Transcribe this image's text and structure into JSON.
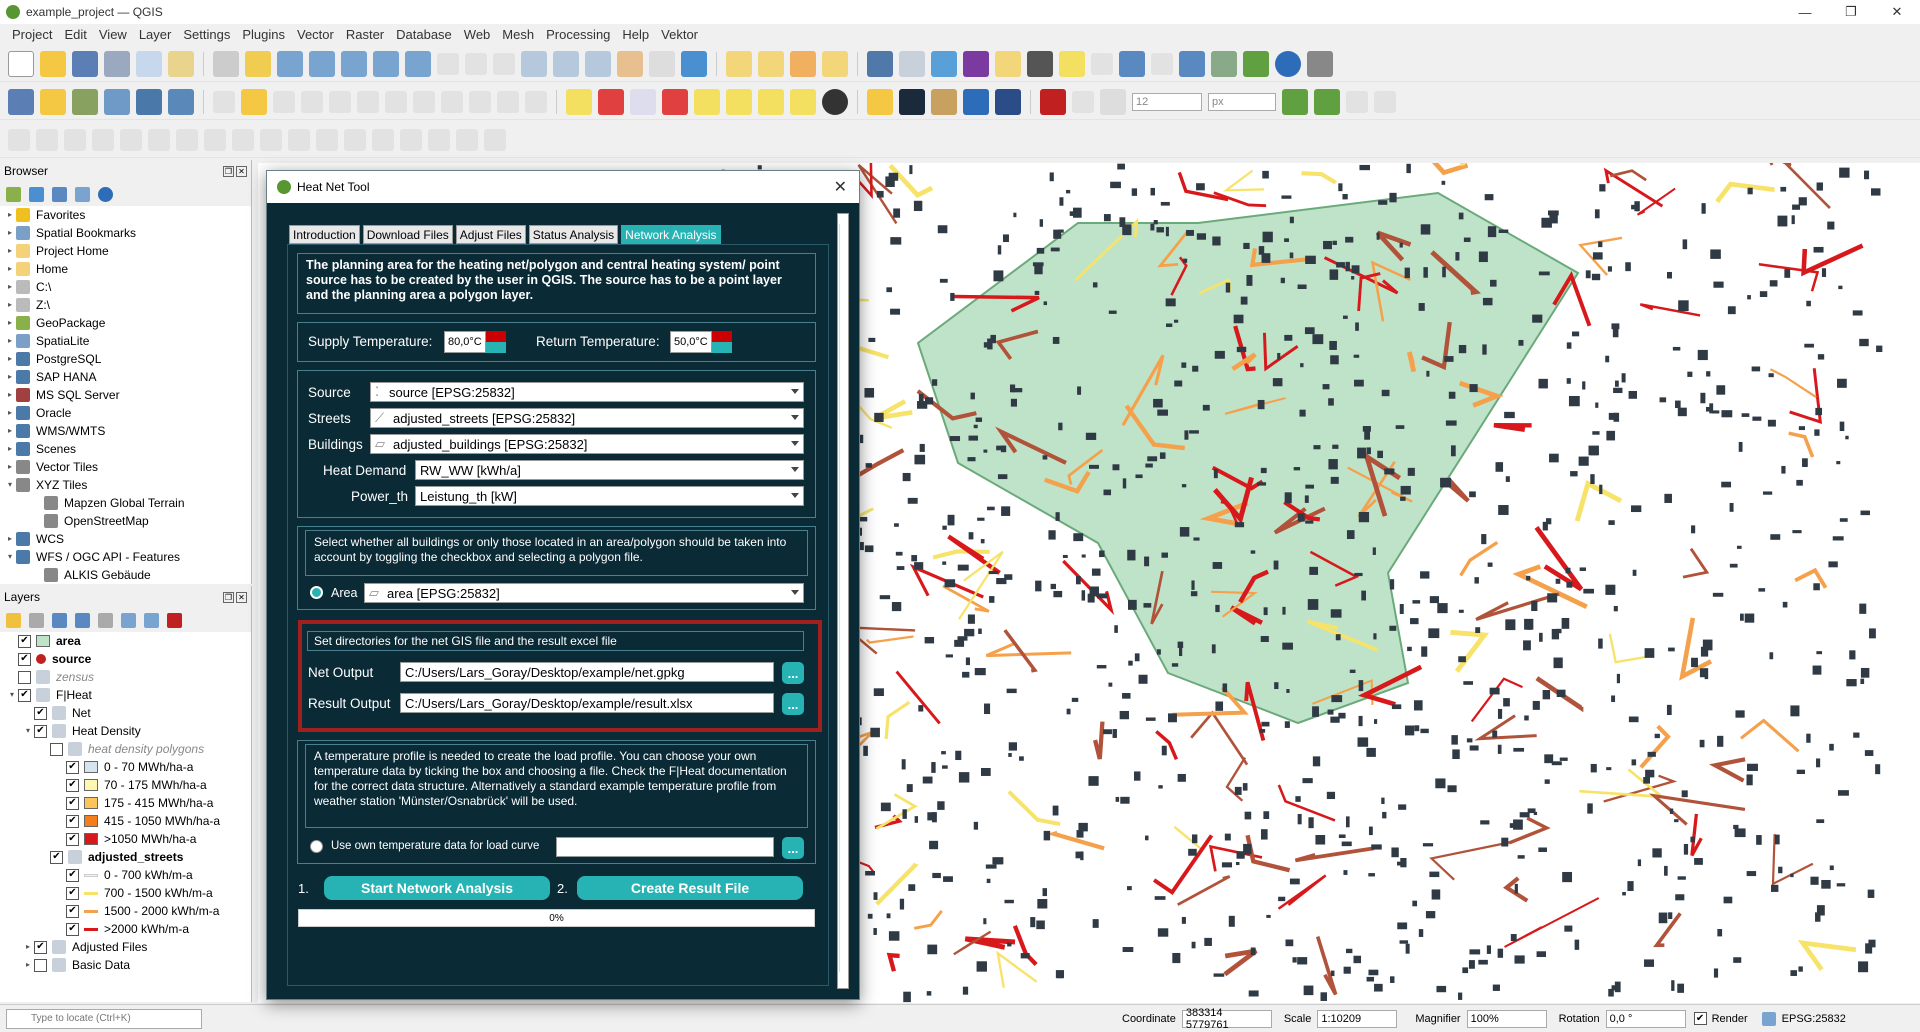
{
  "window": {
    "title": "example_project — QGIS",
    "controls": [
      "—",
      "❐",
      "✕"
    ]
  },
  "menu": [
    "Project",
    "Edit",
    "View",
    "Layer",
    "Settings",
    "Plugins",
    "Vector",
    "Raster",
    "Database",
    "Web",
    "Mesh",
    "Processing",
    "Help",
    "Vektor"
  ],
  "browser": {
    "title": "Browser",
    "items": [
      {
        "label": "Favorites",
        "icon": "star-icon",
        "color": "#f0c020"
      },
      {
        "label": "Spatial Bookmarks",
        "icon": "bookmark-icon",
        "color": "#7aa0c8"
      },
      {
        "label": "Project Home",
        "icon": "folder-icon",
        "color": "#f4d27a"
      },
      {
        "label": "Home",
        "icon": "folder-icon",
        "color": "#f4d27a"
      },
      {
        "label": "C:\\",
        "icon": "drive-icon",
        "color": "#bbbbbb"
      },
      {
        "label": "Z:\\",
        "icon": "drive-icon",
        "color": "#bbbbbb"
      },
      {
        "label": "GeoPackage",
        "icon": "geopackage-icon",
        "color": "#8ab04a"
      },
      {
        "label": "SpatiaLite",
        "icon": "spatialite-icon",
        "color": "#7aa0c8"
      },
      {
        "label": "PostgreSQL",
        "icon": "postgresql-icon",
        "color": "#4c7aa8"
      },
      {
        "label": "SAP HANA",
        "icon": "sap-hana-icon",
        "color": "#4c7aa8"
      },
      {
        "label": "MS SQL Server",
        "icon": "mssql-icon",
        "color": "#a04040"
      },
      {
        "label": "Oracle",
        "icon": "oracle-icon",
        "color": "#4c7aa8"
      },
      {
        "label": "WMS/WMTS",
        "icon": "globe-icon",
        "color": "#4c7aa8"
      },
      {
        "label": "Scenes",
        "icon": "scenes-icon",
        "color": "#4c7aa8"
      },
      {
        "label": "Vector Tiles",
        "icon": "vector-tiles-icon",
        "color": "#888888"
      },
      {
        "label": "XYZ Tiles",
        "icon": "xyz-tiles-icon",
        "color": "#888888"
      },
      {
        "label": "Mapzen Global Terrain",
        "icon": "tile-icon",
        "color": "#888888"
      },
      {
        "label": "OpenStreetMap",
        "icon": "tile-icon",
        "color": "#888888"
      },
      {
        "label": "WCS",
        "icon": "globe-icon",
        "color": "#4c7aa8"
      },
      {
        "label": "WFS / OGC API - Features",
        "icon": "globe-icon",
        "color": "#4c7aa8"
      },
      {
        "label": "ALKIS Gebäude",
        "icon": "tile-icon",
        "color": "#888888"
      }
    ]
  },
  "layers": {
    "title": "Layers",
    "items": [
      {
        "label": "area",
        "bold": true,
        "checked": true,
        "indent": 0,
        "sw": "#bfe3c9"
      },
      {
        "label": "source",
        "bold": true,
        "checked": true,
        "indent": 0,
        "dot": "#c02020"
      },
      {
        "label": "zensus",
        "italic": true,
        "checked": false,
        "indent": 0
      },
      {
        "label": "F|Heat",
        "checked": true,
        "indent": 0,
        "group": true
      },
      {
        "label": "Net",
        "checked": true,
        "indent": 1
      },
      {
        "label": "Heat Density",
        "checked": true,
        "indent": 1,
        "group": true
      },
      {
        "label": "heat density polygons",
        "italic": true,
        "checked": false,
        "indent": 2
      },
      {
        "label": "0 - 70 MWh/ha-a",
        "checked": true,
        "indent": 3,
        "sw": "#d6e4f0"
      },
      {
        "label": "70 - 175 MWh/ha-a",
        "checked": true,
        "indent": 3,
        "sw": "#fff7b0"
      },
      {
        "label": "175 - 415 MWh/ha-a",
        "checked": true,
        "indent": 3,
        "sw": "#fdc45c"
      },
      {
        "label": "415 - 1050 MWh/ha-a",
        "checked": true,
        "indent": 3,
        "sw": "#f57d1c"
      },
      {
        "label": ">1050 MWh/ha-a",
        "checked": true,
        "indent": 3,
        "sw": "#d7191c"
      },
      {
        "label": "adjusted_streets",
        "bold": true,
        "checked": true,
        "indent": 2
      },
      {
        "label": "0 - 700 kWh/m-a",
        "checked": true,
        "indent": 3,
        "ln": "#f4f4f4"
      },
      {
        "label": "700 - 1500 kWh/m-a",
        "checked": true,
        "indent": 3,
        "ln": "#f7e36a"
      },
      {
        "label": "1500 - 2000 kWh/m-a",
        "checked": true,
        "indent": 3,
        "ln": "#f5a04a"
      },
      {
        "label": ">2000 kWh/m-a",
        "checked": true,
        "indent": 3,
        "ln": "#d7191c"
      },
      {
        "label": "Adjusted Files",
        "checked": true,
        "indent": 1,
        "group": true
      },
      {
        "label": "Basic Data",
        "checked": false,
        "indent": 1,
        "group": true
      }
    ]
  },
  "dialog": {
    "title": "Heat Net Tool",
    "tabs": [
      "Introduction",
      "Download Files",
      "Adjust Files",
      "Status Analysis",
      "Network Analysis"
    ],
    "intro": "The planning area for the heating net/polygon and central heating system/ point source has to be created by the user in QGIS. The source has to be a point layer and the planning area a polygon layer.",
    "supply_label": "Supply Temperature:",
    "supply_value": "80,0°C",
    "return_label": "Return Temperature:",
    "return_value": "50,0°C",
    "source_label": "Source",
    "source_value": "source [EPSG:25832]",
    "streets_label": "Streets",
    "streets_value": "adjusted_streets [EPSG:25832]",
    "buildings_label": "Buildings",
    "buildings_value": "adjusted_buildings [EPSG:25832]",
    "heat_label": "Heat Demand",
    "heat_value": "RW_WW [kWh/a]",
    "power_label": "Power_th",
    "power_value": "Leistung_th [kW]",
    "area_info": "Select whether all buildings or only those located in an area/polygon should be taken into account by toggling the checkbox and selecting a polygon file.",
    "area_label": "Area",
    "area_value": "area [EPSG:25832]",
    "dir_info": "Set directories for the net GIS file and the result excel file",
    "net_label": "Net Output",
    "net_value": "C:/Users/Lars_Goray/Desktop/example/net.gpkg",
    "result_label": "Result Output",
    "result_value": "C:/Users/Lars_Goray/Desktop/example/result.xlsx",
    "browse": "...",
    "temp_info": "A temperature profile is needed to create the load profile. You can choose your own temperature data by ticking the box and choosing a file. Check the F|Heat documentation for the correct data structure. Alternatively a standard example temperature profile from weather station 'Münster/Osnabrück' will be used.",
    "own_temp_label": "Use own temperature data for load curve",
    "step1": "1.",
    "start_btn": "Start Network Analysis",
    "step2": "2.",
    "result_btn": "Create Result File",
    "progress": "0%"
  },
  "status": {
    "locate_placeholder": "Type to locate (Ctrl+K)",
    "coord_label": "Coordinate",
    "coord_value": "383314  5779761",
    "scale_label": "Scale",
    "scale_value": "1:10209",
    "magnifier_label": "Magnifier",
    "magnifier_value": "100%",
    "rotation_label": "Rotation",
    "rotation_value": "0,0 °",
    "render_label": "Render",
    "crs": "EPSG:25832"
  },
  "toolbar": {
    "font_size": "12",
    "unit": "px"
  }
}
